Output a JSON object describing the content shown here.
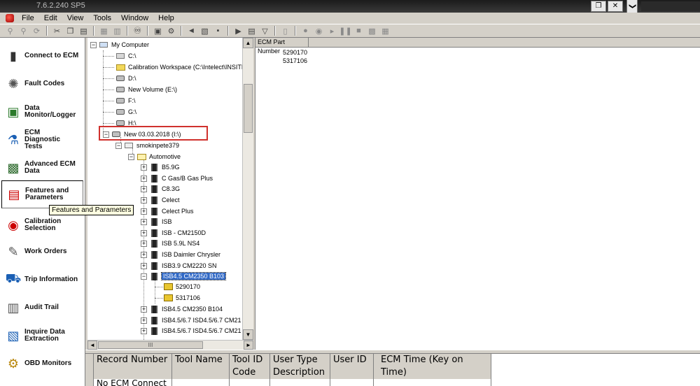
{
  "app": {
    "version": "7.6.2.240 SP5"
  },
  "menu": [
    "File",
    "Edit",
    "View",
    "Tools",
    "Window",
    "Help"
  ],
  "window_controls": {
    "restore": "❐",
    "close": "✕",
    "chevron": "❯"
  },
  "nav": [
    {
      "label": "Connect to ECM",
      "icon": "connect-icon"
    },
    {
      "label": "Fault Codes",
      "icon": "fault-codes-icon"
    },
    {
      "label": "Data Monitor/Logger",
      "icon": "data-monitor-icon"
    },
    {
      "label": "ECM Diagnostic Tests",
      "icon": "diagnostic-tests-icon"
    },
    {
      "label": "Advanced ECM Data",
      "icon": "advanced-data-icon"
    },
    {
      "label": "Features and Parameters",
      "icon": "features-parameters-icon"
    },
    {
      "label": "Calibration Selection",
      "icon": "calibration-selection-icon"
    },
    {
      "label": "Work Orders",
      "icon": "work-orders-icon"
    },
    {
      "label": "Trip Information",
      "icon": "trip-information-icon"
    },
    {
      "label": "Audit Trail",
      "icon": "audit-trail-icon"
    },
    {
      "label": "Inquire Data Extraction",
      "icon": "inquire-data-icon"
    },
    {
      "label": "OBD Monitors",
      "icon": "obd-monitors-icon"
    }
  ],
  "tooltip": "Features and Parameters",
  "tree": {
    "root": "My Computer",
    "drives": [
      "C:\\",
      "Calibration Workspace  (C:\\Intelect\\INSITE",
      "D:\\",
      "New Volume  (E:\\)",
      "F:\\",
      "G:\\",
      "H:\\"
    ],
    "selected_drive": "New 03.03.2018  (I:\\)",
    "user_folder": "smokinpete379",
    "category": "Automotive",
    "engines": [
      "B5.9G",
      "C Gas/B Gas Plus",
      "C8.3G",
      "Celect",
      "Celect Plus",
      "ISB",
      "ISB - CM2150D",
      "ISB 5.9L NS4",
      "ISB Daimler Chrysler",
      "ISB3.9 CM2220 SN"
    ],
    "expanded_engine": "ISB4.5 CM2350 B103",
    "calibrations": [
      "5290170",
      "5317106"
    ],
    "more_engines": [
      "ISB4.5 CM2350 B104",
      "ISB4.5/6.7 ISD4.5/6.7 CM21",
      "ISB4.5/6.7 ISD4.5/6.7 CM21"
    ]
  },
  "list": {
    "header": "ECM Part Number",
    "rows": [
      "5290170",
      "5317106"
    ]
  },
  "grid": {
    "headers": [
      [
        "Record Number",
        ""
      ],
      [
        "Tool Name",
        ""
      ],
      [
        "Tool ID",
        "Code"
      ],
      [
        "User Type",
        "Description"
      ],
      [
        "User ID",
        ""
      ],
      [
        "ECM Time (Key on Time)",
        ""
      ]
    ],
    "first_cell": "No ECM Connect"
  },
  "scroll": {
    "up": "▲",
    "down": "▼",
    "left": "◄",
    "right": "►",
    "grip": "III"
  }
}
